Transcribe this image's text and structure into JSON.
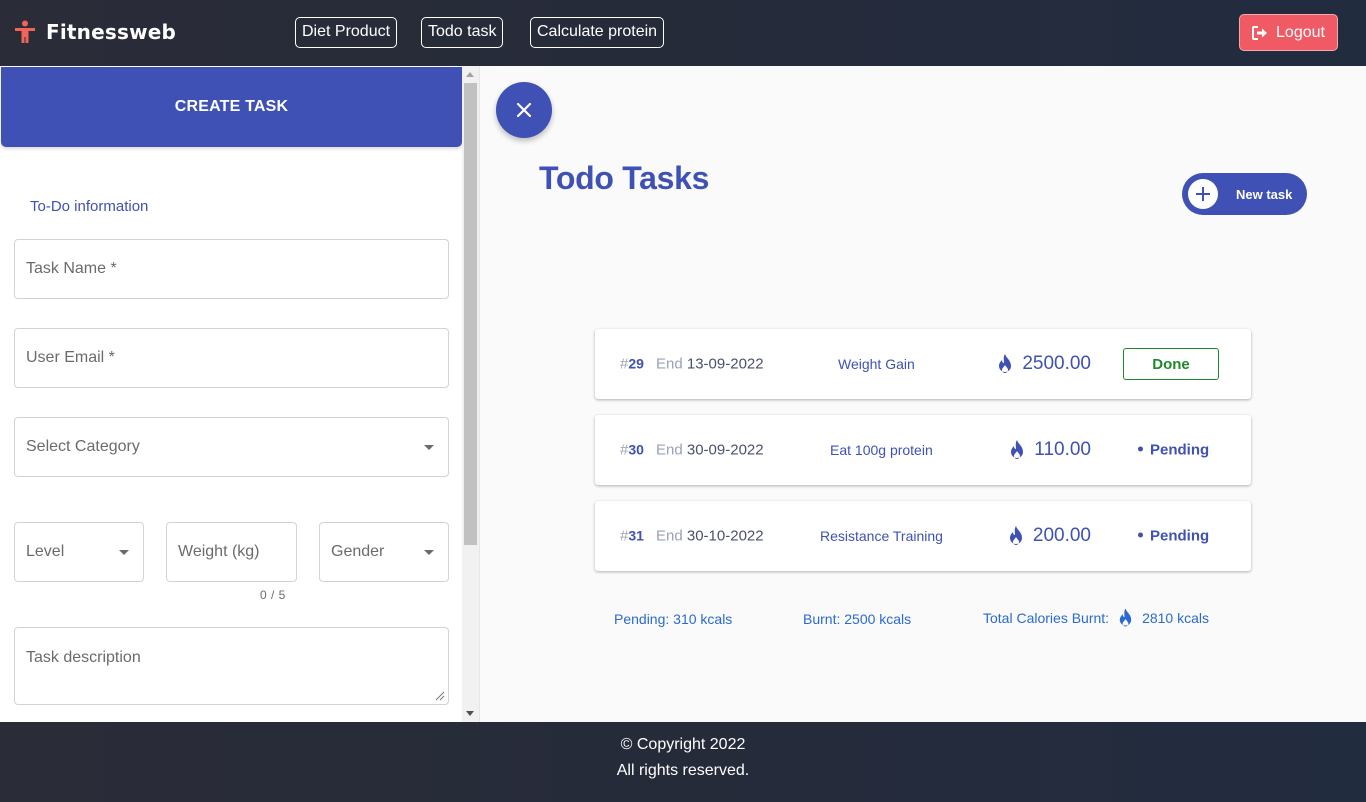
{
  "header": {
    "brand": "Fitnessweb",
    "nav": [
      {
        "label": "Diet Product"
      },
      {
        "label": "Todo task"
      },
      {
        "label": "Calculate protein"
      }
    ],
    "logout_label": "Logout"
  },
  "form": {
    "title": "CREATE TASK",
    "section_label": "To-Do information",
    "task_name_placeholder": "Task Name *",
    "user_email_placeholder": "User Email *",
    "category_placeholder": "Select Category",
    "level_placeholder": "Level",
    "weight_placeholder": "Weight (kg)",
    "weight_counter": "0 / 5",
    "gender_placeholder": "Gender",
    "description_placeholder": "Task description"
  },
  "main": {
    "title": "Todo Tasks",
    "new_task_label": "New task",
    "tasks": [
      {
        "hash": "#",
        "id": "29",
        "end_label": "End",
        "end_date": "13-09-2022",
        "category": "Weight Gain",
        "calories": "2500.00",
        "status": "Done"
      },
      {
        "hash": "#",
        "id": "30",
        "end_label": "End",
        "end_date": "30-09-2022",
        "category": "Eat 100g protein",
        "calories": "110.00",
        "status": "Pending"
      },
      {
        "hash": "#",
        "id": "31",
        "end_label": "End",
        "end_date": "30-10-2022",
        "category": "Resistance Training",
        "calories": "200.00",
        "status": "Pending"
      }
    ],
    "summary": {
      "pending": "Pending: 310 kcals",
      "burnt": "Burnt: 2500 kcals",
      "total_label": "Total Calories Burnt:",
      "total_value": "2810 kcals"
    }
  },
  "footer": {
    "copyright": "© Copyright 2022",
    "rights": "All rights reserved."
  },
  "colors": {
    "accent": "#3f51b5",
    "logout": "#f05a64",
    "done": "#1f8a2a",
    "header_bg": "#252b3b"
  },
  "icons": [
    "person-icon",
    "logout-icon",
    "close-icon",
    "plus-icon",
    "flame-icon",
    "chevron-down-icon"
  ]
}
